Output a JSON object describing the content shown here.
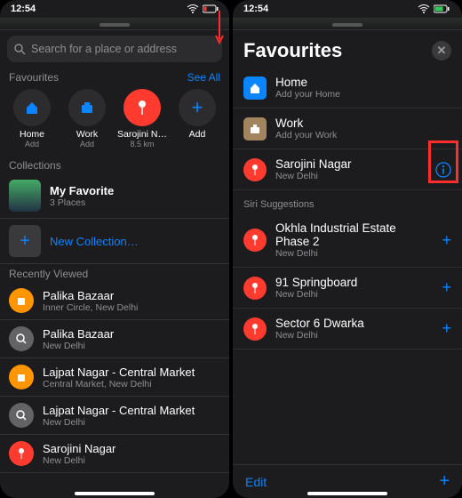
{
  "status": {
    "time": "12:54",
    "battery_left": "low",
    "battery_right": "charging"
  },
  "left": {
    "search_placeholder": "Search for a place or address",
    "favourites_label": "Favourites",
    "see_all": "See All",
    "fav_items": [
      {
        "label": "Home",
        "sub": "Add"
      },
      {
        "label": "Work",
        "sub": "Add"
      },
      {
        "label": "Sarojini N…",
        "sub": "8.5 km"
      },
      {
        "label": "Add",
        "sub": ""
      }
    ],
    "collections_label": "Collections",
    "my_fav": {
      "title": "My Favorite",
      "sub": "3 Places"
    },
    "new_collection": "New Collection…",
    "recent_label": "Recently Viewed",
    "recent": [
      {
        "title": "Palika Bazaar",
        "sub": "Inner Circle, New Delhi",
        "c": "orange"
      },
      {
        "title": "Palika Bazaar",
        "sub": "New Delhi",
        "c": "gray"
      },
      {
        "title": "Lajpat Nagar - Central Market",
        "sub": "Central Market, New Delhi",
        "c": "orange"
      },
      {
        "title": "Lajpat Nagar - Central Market",
        "sub": "New Delhi",
        "c": "gray"
      },
      {
        "title": "Sarojini Nagar",
        "sub": "New Delhi",
        "c": "red"
      }
    ]
  },
  "right": {
    "title": "Favourites",
    "items": [
      {
        "title": "Home",
        "sub": "Add your Home",
        "kind": "home"
      },
      {
        "title": "Work",
        "sub": "Add your Work",
        "kind": "work"
      },
      {
        "title": "Sarojini Nagar",
        "sub": "New Delhi",
        "kind": "pin",
        "trail": "info"
      }
    ],
    "siri_label": "Siri Suggestions",
    "siri": [
      {
        "title": "Okhla Industrial Estate Phase 2",
        "sub": "New Delhi"
      },
      {
        "title": "91 Springboard",
        "sub": "New Delhi"
      },
      {
        "title": "Sector 6 Dwarka",
        "sub": "New Delhi"
      }
    ],
    "edit": "Edit"
  }
}
